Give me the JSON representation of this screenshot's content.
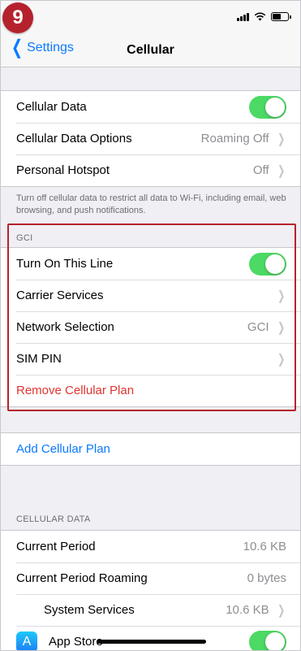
{
  "step_badge": "9",
  "nav": {
    "back_label": "Settings",
    "title": "Cellular"
  },
  "group1": {
    "rows": [
      {
        "label": "Cellular Data",
        "toggle": "on"
      },
      {
        "label": "Cellular Data Options",
        "value": "Roaming Off"
      },
      {
        "label": "Personal Hotspot",
        "value": "Off"
      }
    ],
    "note": "Turn off cellular data to restrict all data to Wi-Fi, including email, web browsing, and push notifications."
  },
  "gci_section": {
    "header": "GCI",
    "rows": [
      {
        "label": "Turn On This Line",
        "toggle": "on"
      },
      {
        "label": "Carrier Services",
        "value": ""
      },
      {
        "label": "Network Selection",
        "value": "GCI"
      },
      {
        "label": "SIM PIN",
        "value": ""
      },
      {
        "label": "Remove Cellular Plan"
      }
    ]
  },
  "add_plan_label": "Add Cellular Plan",
  "cellular_data": {
    "header": "CELLULAR DATA",
    "rows": [
      {
        "label": "Current Period",
        "value": "10.6 KB"
      },
      {
        "label": "Current Period Roaming",
        "value": "0 bytes"
      },
      {
        "label": "System Services",
        "value": "10.6 KB"
      },
      {
        "label": "App Store",
        "toggle": "on"
      }
    ]
  },
  "colors": {
    "accent": "#0a7aff",
    "toggle_on": "#4cd964",
    "destructive": "#e0332e",
    "highlight": "#b5222d"
  }
}
